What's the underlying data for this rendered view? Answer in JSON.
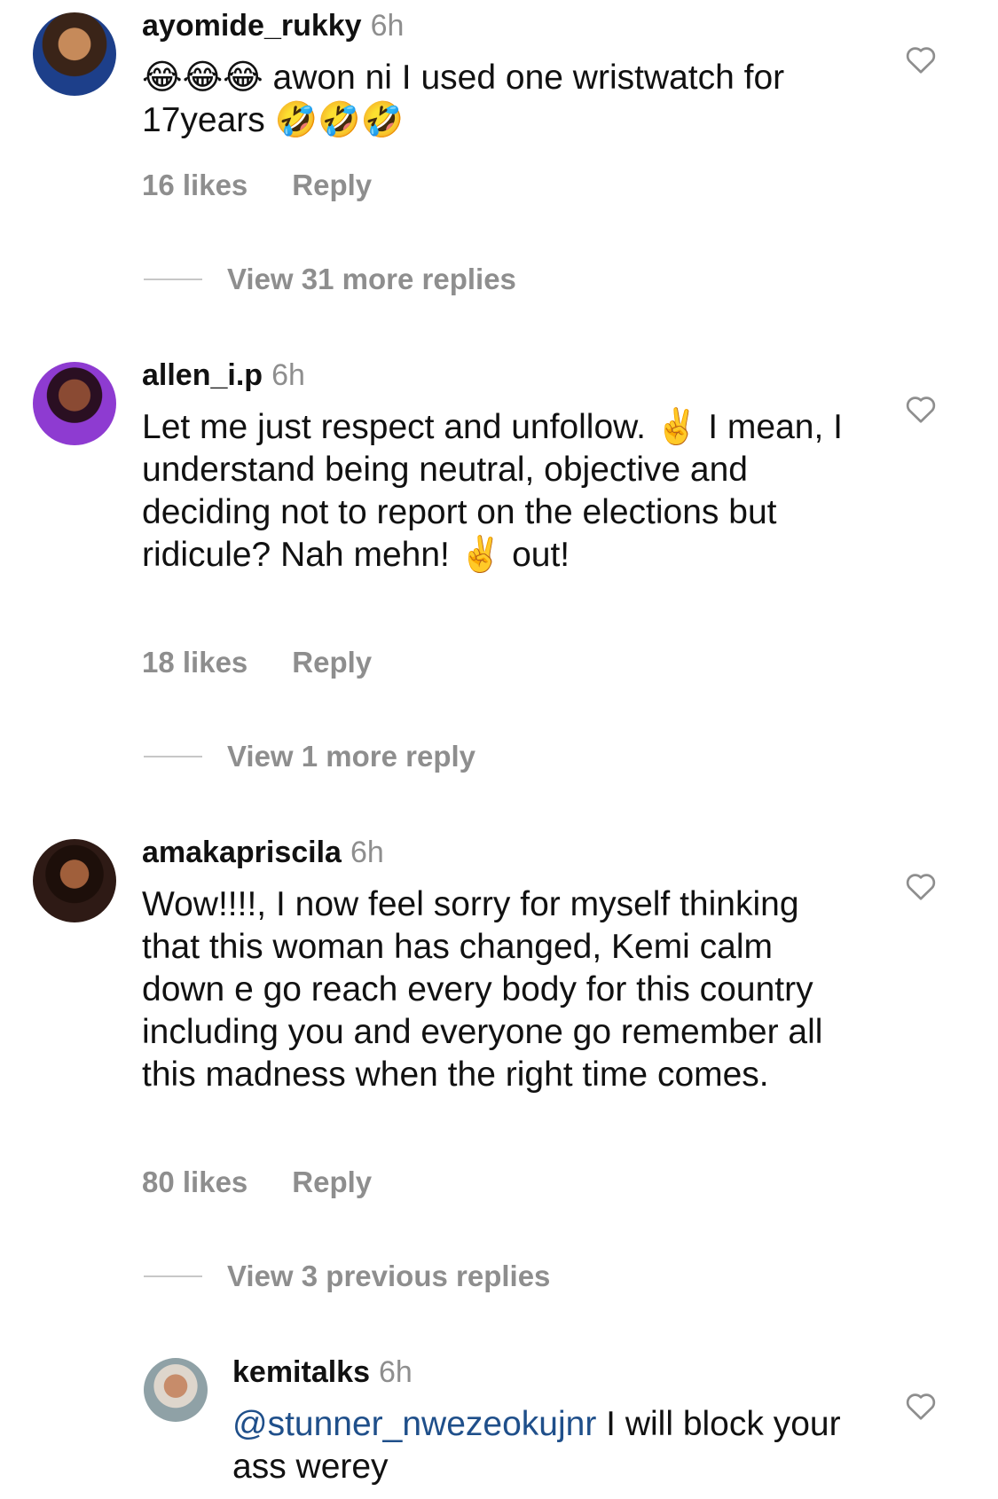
{
  "comments": [
    {
      "username": "ayomide_rukky",
      "time": "6h",
      "text": "😂😂😂 awon ni I used one wristwatch for 17years 🤣🤣🤣",
      "likes": "16 likes",
      "reply": "Reply",
      "view_replies": "View 31 more replies"
    },
    {
      "username": "allen_i.p",
      "time": "6h",
      "text": "Let me just respect and unfollow. ✌️ I mean, I understand being neutral, objective and deciding not to report on the elections but ridicule? Nah mehn! ✌️ out!",
      "likes": "18 likes",
      "reply": "Reply",
      "view_replies": "View 1 more reply"
    },
    {
      "username": "amakapriscila",
      "time": "6h",
      "text": "Wow!!!!, I now feel sorry for myself thinking that this woman has changed, Kemi calm down e go reach every body for this country including you and everyone go remember all this madness when the right time comes.",
      "likes": "80 likes",
      "reply": "Reply",
      "view_replies": "View 3 previous replies"
    }
  ],
  "reply_comment": {
    "username": "kemitalks",
    "time": "6h",
    "mention": "@stunner_nwezeokujnr",
    "text": " I will block your ass werey"
  },
  "icons": {
    "like": "heart-outline-icon"
  },
  "colors": {
    "muted": "#8e8e8e",
    "mention": "#1f4f8a",
    "text": "#111111"
  }
}
